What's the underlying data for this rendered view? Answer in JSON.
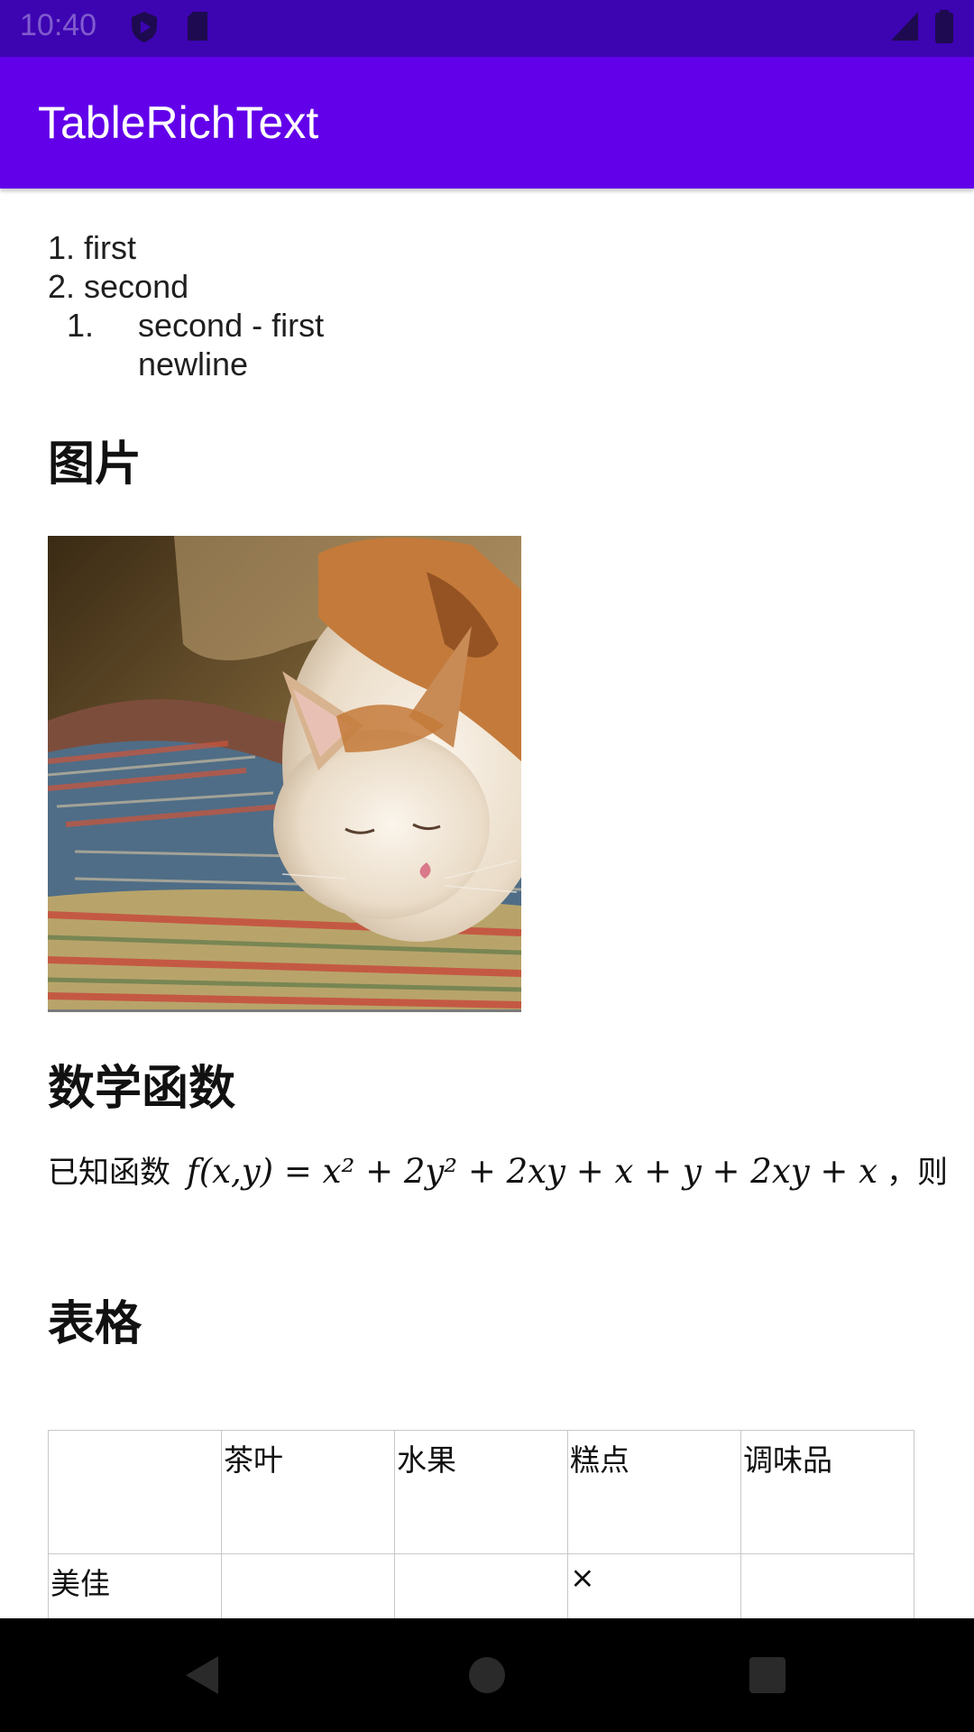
{
  "status_bar": {
    "time": "10:40",
    "icons": [
      "shield-icon",
      "sd-card-icon",
      "signal-icon",
      "battery-icon"
    ]
  },
  "app_bar": {
    "title": "TableRichText"
  },
  "list": {
    "items": [
      "1. first",
      "2. second"
    ],
    "sub_marker": "1.",
    "sub_item_line1": "second - first",
    "sub_item_line2": "newline"
  },
  "sections": {
    "image_heading": "图片",
    "math_heading": "数学函数",
    "table_heading": "表格"
  },
  "math": {
    "prefix": "已知函数",
    "formula": "f(x,y) = x² + 2y² + 2xy + x + y + 2xy + x",
    "suffix": "，则"
  },
  "table": {
    "header": [
      "",
      "茶叶",
      "水果",
      "糕点",
      "调味品"
    ],
    "rows": [
      [
        "美佳",
        "",
        "",
        "×",
        ""
      ]
    ]
  },
  "navigation": {
    "buttons": [
      "back-icon",
      "home-icon",
      "recents-icon"
    ]
  }
}
